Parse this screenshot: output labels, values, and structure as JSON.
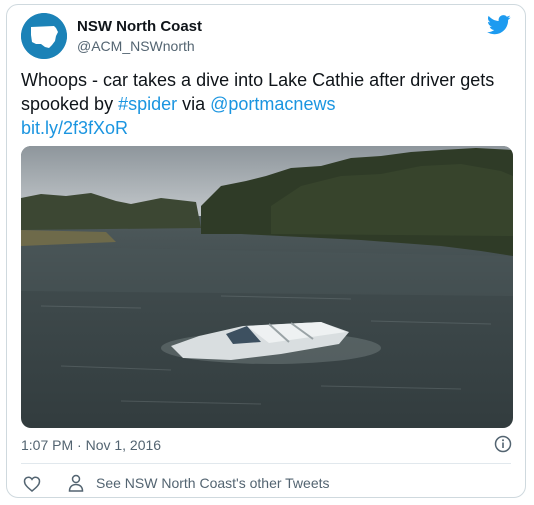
{
  "author": {
    "name": "NSW North Coast",
    "handle": "@ACM_NSWnorth"
  },
  "tweet": {
    "text_before": "Whoops - car takes a dive into Lake Cathie after driver gets spooked by ",
    "hashtag": "#spider",
    "text_middle": " via ",
    "mention": "@portmacnews",
    "link": "bit.ly/2f3fXoR"
  },
  "timestamp": "1:07 PM · Nov 1, 2016",
  "footer": {
    "other_tweets_label": "See NSW North Coast's other Tweets"
  },
  "colors": {
    "link": "#1b95e0",
    "twitter_blue": "#1d9bf0",
    "avatar": "#1b82b7"
  },
  "icons": [
    "avatar-nsw-map",
    "twitter-bird-icon",
    "info-icon",
    "heart-icon",
    "person-icon"
  ]
}
